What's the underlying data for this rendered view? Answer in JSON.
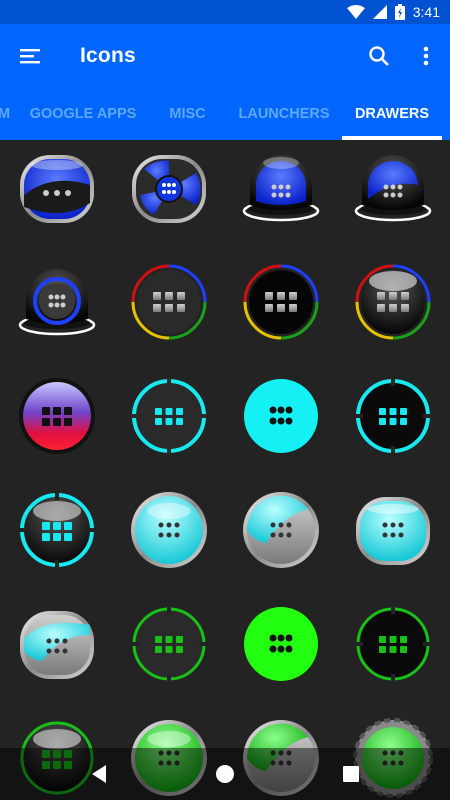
{
  "status_bar": {
    "time": "3:41",
    "icons": [
      "wifi-icon",
      "signal-icon",
      "battery-icon"
    ]
  },
  "app_bar": {
    "title": "Icons",
    "menu_icon": "hamburger-menu-icon",
    "search_icon": "search-icon",
    "more_icon": "more-vert-icon"
  },
  "tabs": [
    "M",
    "GOOGLE APPS",
    "MISC",
    "LAUNCHERS",
    "DRAWERS"
  ],
  "active_tab": "DRAWERS",
  "colors": {
    "status_bar": "#0052d1",
    "app_bar": "#0066ff",
    "tab_inactive": "#5ea8ff",
    "tab_active": "#ffffff",
    "background": "#232323"
  },
  "icons": [
    {
      "name": "drawer-icon-1",
      "style": "glass-oval-blue"
    },
    {
      "name": "drawer-icon-2",
      "style": "glass-fan-blue"
    },
    {
      "name": "drawer-icon-3",
      "style": "dome-blue"
    },
    {
      "name": "drawer-icon-4",
      "style": "dome-blue-black"
    },
    {
      "name": "drawer-icon-5",
      "style": "dome-black-blue-ring"
    },
    {
      "name": "drawer-icon-6",
      "style": "google-ring-dark"
    },
    {
      "name": "drawer-icon-7",
      "style": "google-ring-black"
    },
    {
      "name": "drawer-icon-8",
      "style": "google-ring-gloss"
    },
    {
      "name": "drawer-icon-9",
      "style": "purple-red-gradient"
    },
    {
      "name": "drawer-icon-10",
      "style": "cyan-ring-dark"
    },
    {
      "name": "drawer-icon-11",
      "style": "cyan-solid"
    },
    {
      "name": "drawer-icon-12",
      "style": "cyan-ring-black"
    },
    {
      "name": "drawer-icon-13",
      "style": "cyan-ring-gloss"
    },
    {
      "name": "drawer-icon-14",
      "style": "cyan-glass"
    },
    {
      "name": "drawer-icon-15",
      "style": "cyan-grey-glass"
    },
    {
      "name": "drawer-icon-16",
      "style": "cyan-glass-oval"
    },
    {
      "name": "drawer-icon-17",
      "style": "cyan-grey-oval"
    },
    {
      "name": "drawer-icon-18",
      "style": "green-ring-dark"
    },
    {
      "name": "drawer-icon-19",
      "style": "green-solid"
    },
    {
      "name": "drawer-icon-20",
      "style": "green-ring-black"
    },
    {
      "name": "drawer-icon-21",
      "style": "green-ring-gloss"
    },
    {
      "name": "drawer-icon-22",
      "style": "green-glass"
    },
    {
      "name": "drawer-icon-23",
      "style": "green-grey-glass"
    },
    {
      "name": "drawer-icon-24",
      "style": "green-gear"
    }
  ],
  "nav_bar": {
    "back_icon": "back-icon",
    "home_icon": "home-icon",
    "recents_icon": "recents-icon"
  }
}
